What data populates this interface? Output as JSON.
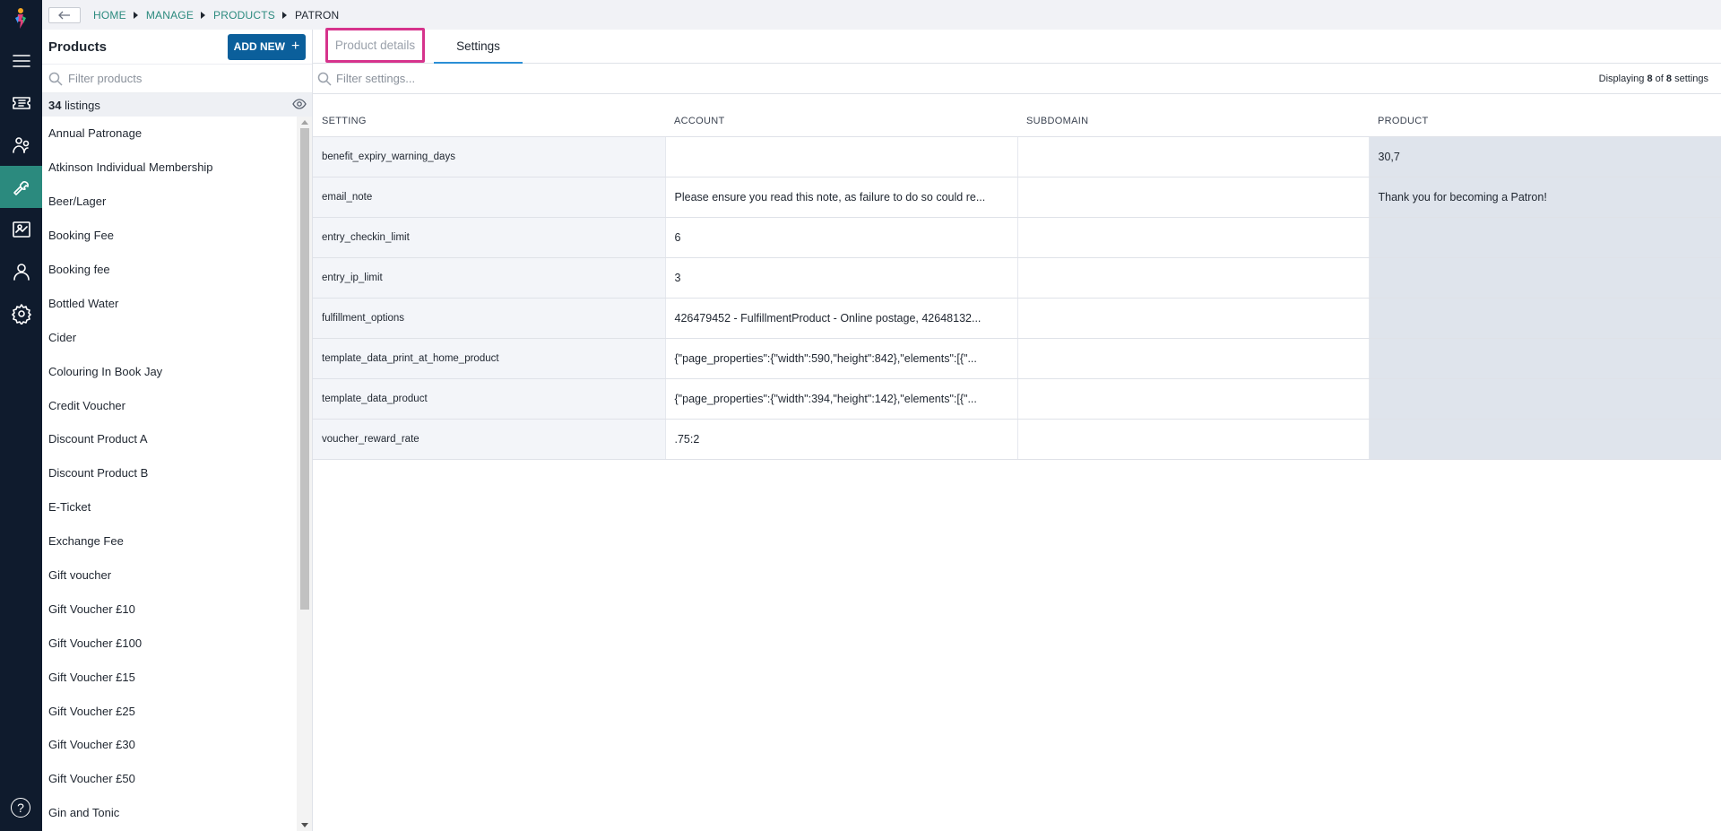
{
  "breadcrumb": {
    "items": [
      "HOME",
      "MANAGE",
      "PRODUCTS"
    ],
    "current": "PATRON"
  },
  "nav": {
    "items": [
      "menu-icon",
      "tickets-icon",
      "customers-icon",
      "tools-icon",
      "reports-icon",
      "user-icon",
      "settings-icon"
    ],
    "active": "tools-icon",
    "help_label": "?"
  },
  "products_panel": {
    "title": "Products",
    "add_button": "ADD NEW",
    "add_button_icon": "+",
    "filter_placeholder": "Filter products",
    "listings_count": "34",
    "listings_label": " listings",
    "items": [
      "Annual Patronage",
      "Atkinson Individual Membership",
      "Beer/Lager",
      "Booking Fee",
      "Booking fee",
      "Bottled Water",
      "Cider",
      "Colouring In Book Jay",
      "Credit Voucher",
      "Discount Product A",
      "Discount Product B",
      "E-Ticket",
      "Exchange Fee",
      "Gift voucher",
      "Gift Voucher £10",
      "Gift Voucher £100",
      "Gift Voucher £15",
      "Gift Voucher £25",
      "Gift Voucher £30",
      "Gift Voucher £50",
      "Gin and Tonic"
    ]
  },
  "tabs": {
    "details": "Product details",
    "settings": "Settings"
  },
  "settings": {
    "filter_placeholder": "Filter settings...",
    "displaying_prefix": "Displaying ",
    "displaying_shown": "8",
    "displaying_mid": " of ",
    "displaying_total": "8",
    "displaying_suffix": " settings",
    "columns": [
      "SETTING",
      "ACCOUNT",
      "SUBDOMAIN",
      "PRODUCT"
    ],
    "rows": [
      [
        "benefit_expiry_warning_days",
        "",
        "",
        "30,7"
      ],
      [
        "email_note",
        "Please ensure you read this note, as failure to do so could re...",
        "",
        "Thank you for becoming a Patron!"
      ],
      [
        "entry_checkin_limit",
        "6",
        "",
        ""
      ],
      [
        "entry_ip_limit",
        "3",
        "",
        ""
      ],
      [
        "fulfillment_options",
        "426479452 - FulfillmentProduct - Online postage, 42648132...",
        "",
        ""
      ],
      [
        "template_data_print_at_home_product",
        "{\"page_properties\":{\"width\":590,\"height\":842},\"elements\":[{\"...",
        "",
        ""
      ],
      [
        "template_data_product",
        "{\"page_properties\":{\"width\":394,\"height\":142},\"elements\":[{\"...",
        "",
        ""
      ],
      [
        "voucher_reward_rate",
        ".75:2",
        "",
        ""
      ]
    ]
  }
}
